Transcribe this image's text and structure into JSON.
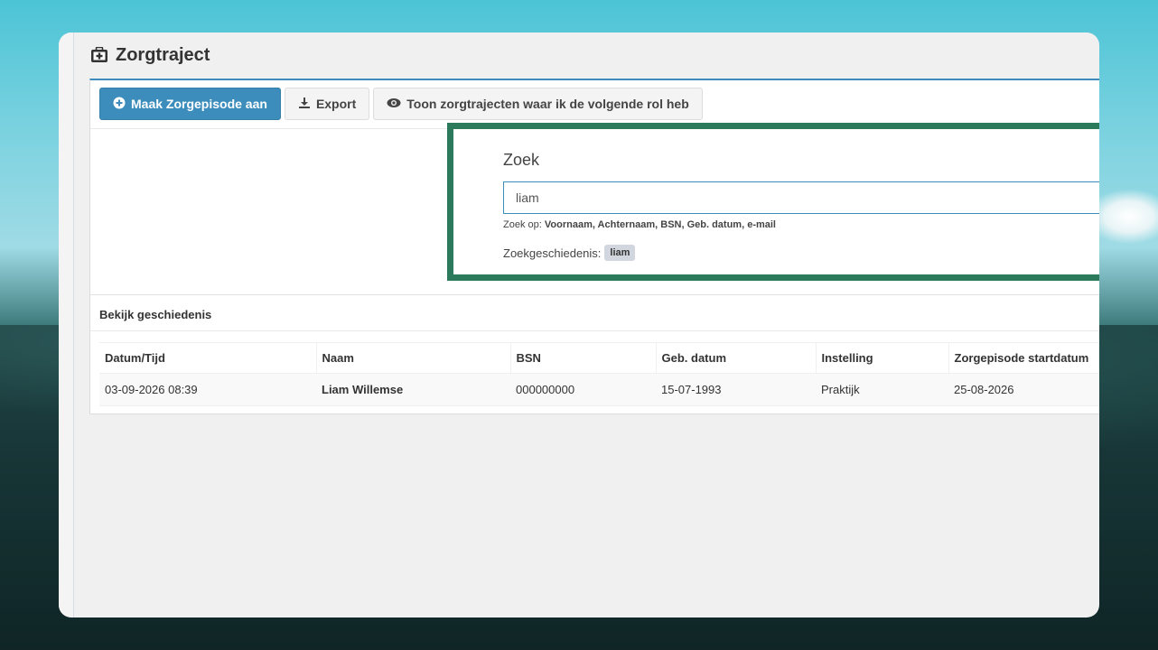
{
  "page": {
    "title": "Zorgtraject",
    "title_icon": "medical-briefcase-icon"
  },
  "toolbar": {
    "create_label": "Maak Zorgepisode aan",
    "create_icon": "plus-circle-icon",
    "export_label": "Export",
    "export_icon": "download-icon",
    "roles_label": "Toon zorgtrajecten waar ik de volgende rol heb",
    "roles_icon": "eye-icon"
  },
  "search": {
    "title": "Zoek",
    "value": "liam",
    "hint_prefix": "Zoek op:",
    "hint_fields": "Voornaam, Achternaam, BSN, Geb. datum, e-mail",
    "history_label": "Zoekgeschiedenis:",
    "history_tags": [
      "liam"
    ],
    "highlight_color": "#2b7a5b"
  },
  "history": {
    "title": "Bekijk geschiedenis",
    "columns": [
      "Datum/Tijd",
      "Naam",
      "BSN",
      "Geb. datum",
      "Instelling",
      "Zorgepisode startdatum"
    ],
    "rows": [
      [
        "03-09-2026 08:39",
        "Liam Willemse",
        "000000000",
        "15-07-1993",
        "Praktijk",
        "25-08-2026"
      ]
    ]
  },
  "colors": {
    "primary": "#3c8dbc"
  }
}
